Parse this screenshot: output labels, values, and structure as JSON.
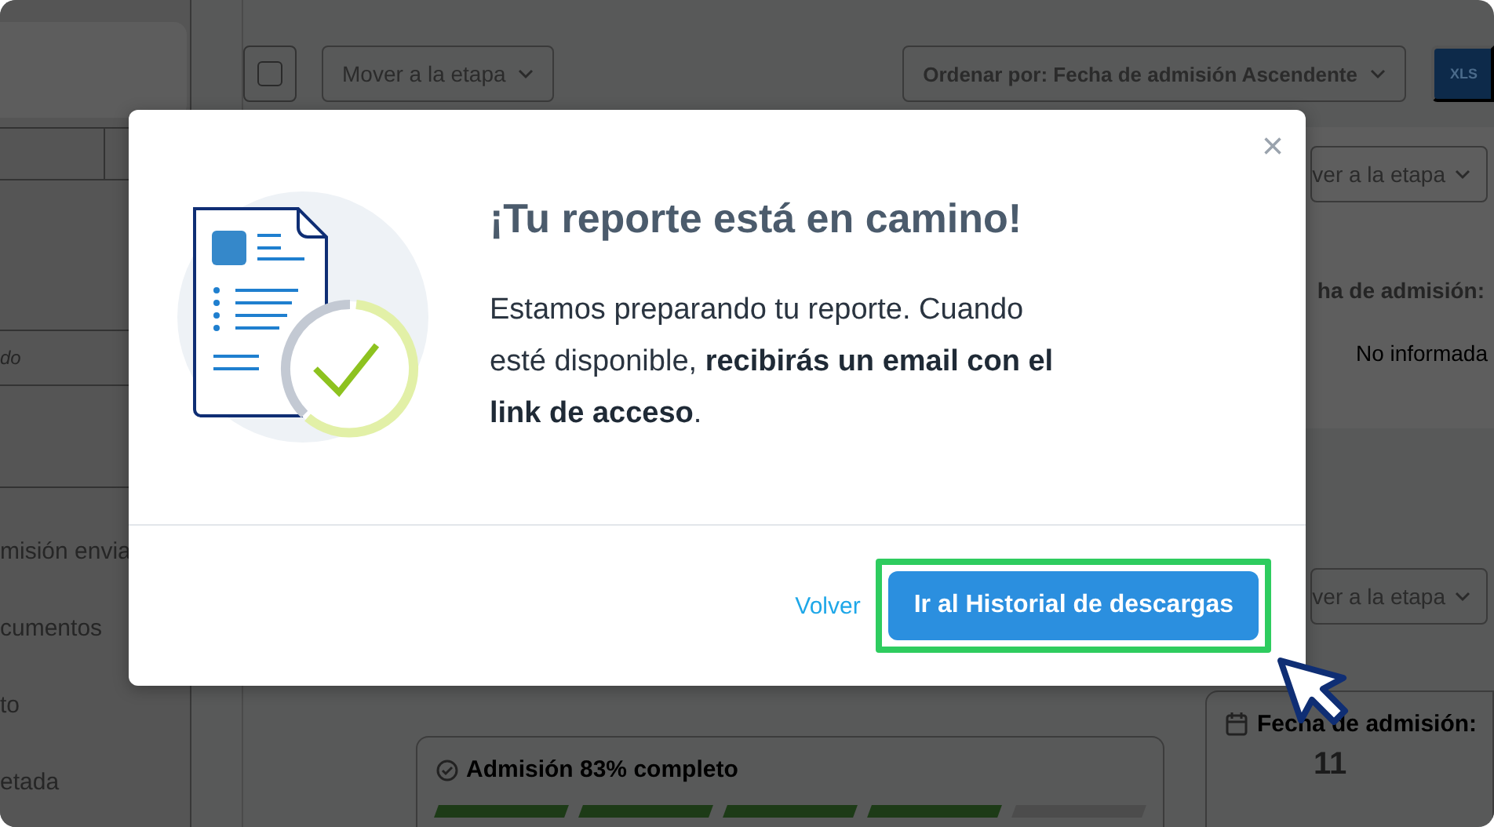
{
  "background": {
    "sidebar_items": [
      {
        "label": "do",
        "kind": "note"
      },
      {
        "label": "misión envia",
        "kind": "stage"
      },
      {
        "label": "cumentos",
        "kind": "stage"
      },
      {
        "label": "to",
        "kind": "stage"
      },
      {
        "label": "etada",
        "kind": "stage"
      }
    ],
    "toolbar": {
      "checkbox": {
        "checked": false
      },
      "stage_dropdown": "Mover a la etapa",
      "sort_dropdown": "Ordenar por: Fecha de admisión Ascendente",
      "export_label": "XLS"
    },
    "detail": {
      "stage_dropdown": "ver a la etapa",
      "date_label": "ha de admisión:",
      "date_value": "No informada",
      "second_stage_dropdown": "ver a la etapa"
    },
    "progress_card": {
      "title": "Admisión 83% completo",
      "segments": [
        {
          "complete": true
        },
        {
          "complete": true
        },
        {
          "complete": true
        },
        {
          "complete": true
        },
        {
          "complete": false
        }
      ]
    },
    "date_card": {
      "title": "Fecha de admisión:",
      "day": "11"
    }
  },
  "modal": {
    "title": "¡Tu reporte está en camino!",
    "body": "Estamos preparando tu reporte. Cuando esté disponible, **recibirás un email con el link de acceso**.",
    "close": "×",
    "back_link": "Volver",
    "primary_button": {
      "label": "Ir al Historial de descargas",
      "highlighted": true
    }
  }
}
